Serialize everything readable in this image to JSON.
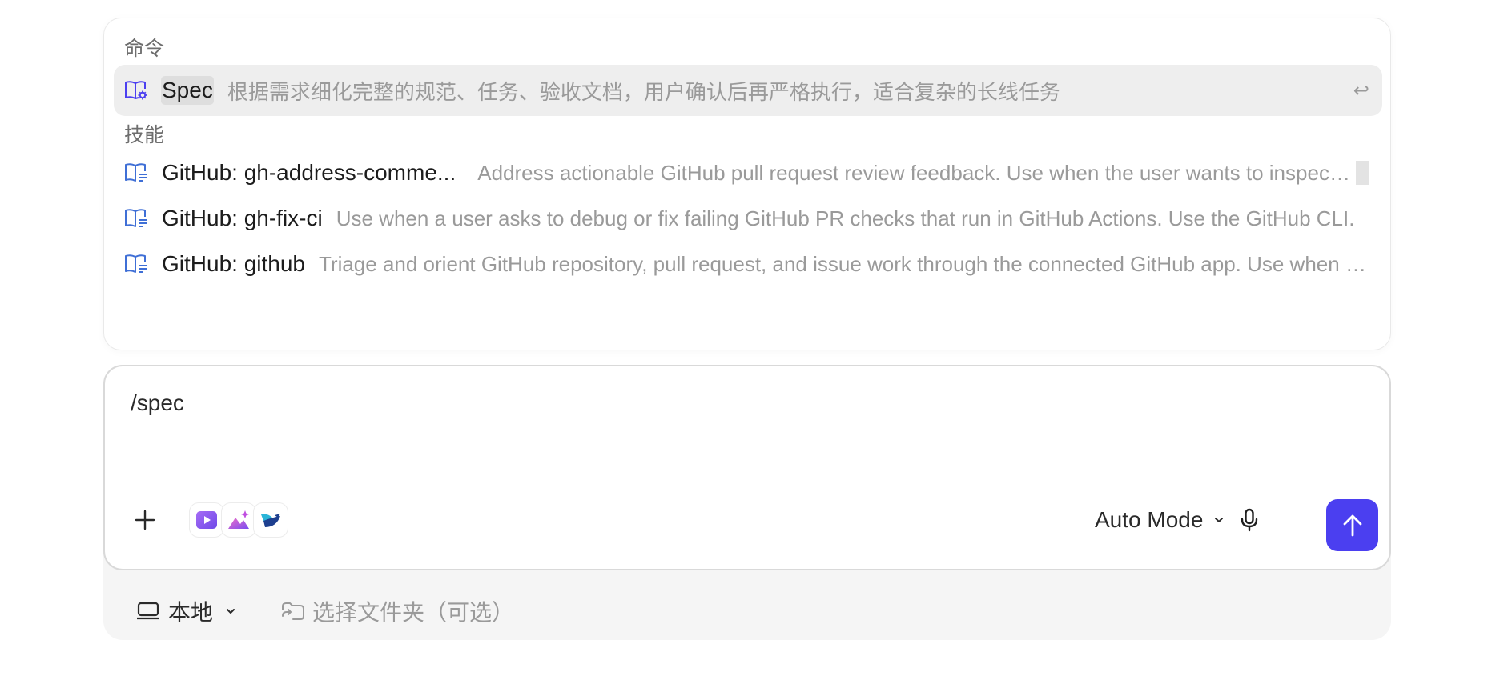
{
  "commands_section": {
    "label": "命令",
    "items": [
      {
        "title": "Spec",
        "description": "根据需求细化完整的规范、任务、验收文档，用户确认后再严格执行，适合复杂的长线任务",
        "enter_hint": "↩"
      }
    ]
  },
  "skills_section": {
    "label": "技能",
    "items": [
      {
        "title": "GitHub: gh-address-comme...",
        "description": "Address actionable GitHub pull request review feedback. Use when the user wants to inspect unresolved review comments."
      },
      {
        "title": "GitHub: gh-fix-ci",
        "description": "Use when a user asks to debug or fix failing GitHub PR checks that run in GitHub Actions. Use the GitHub CLI."
      },
      {
        "title": "GitHub: github",
        "description": "Triage and orient GitHub repository, pull request, and issue work through the connected GitHub app. Use when needed."
      }
    ]
  },
  "composer": {
    "input_value": "/spec",
    "mode_label": "Auto Mode",
    "app_icons": [
      "video-app-icon",
      "image-generation-icon",
      "bird-app-icon"
    ],
    "send_color": "#4b3ff0"
  },
  "footer": {
    "environment_label": "本地",
    "folder_placeholder": "选择文件夹（可选）"
  }
}
